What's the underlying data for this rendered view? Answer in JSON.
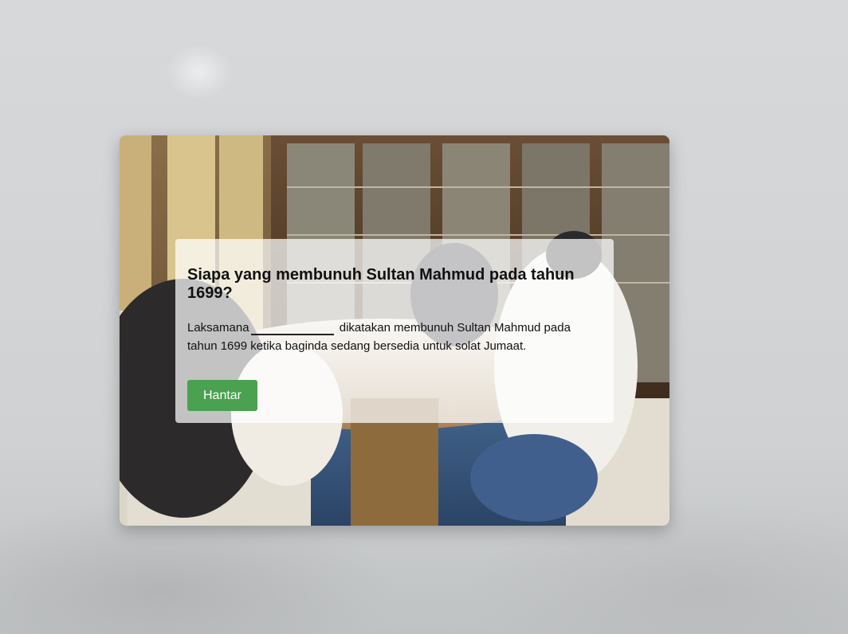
{
  "quiz": {
    "question": "Siapa yang membunuh Sultan Mahmud pada tahun 1699?",
    "sentence_before": "Laksamana",
    "blank_value": "",
    "sentence_after": "dikatakan membunuh Sultan Mahmud pada tahun 1699 ketika baginda sedang bersedia untuk solat Jumaat.",
    "submit_label": "Hantar"
  },
  "colors": {
    "submit_button": "#4aa14f",
    "backdrop": "#d3d5d7"
  }
}
